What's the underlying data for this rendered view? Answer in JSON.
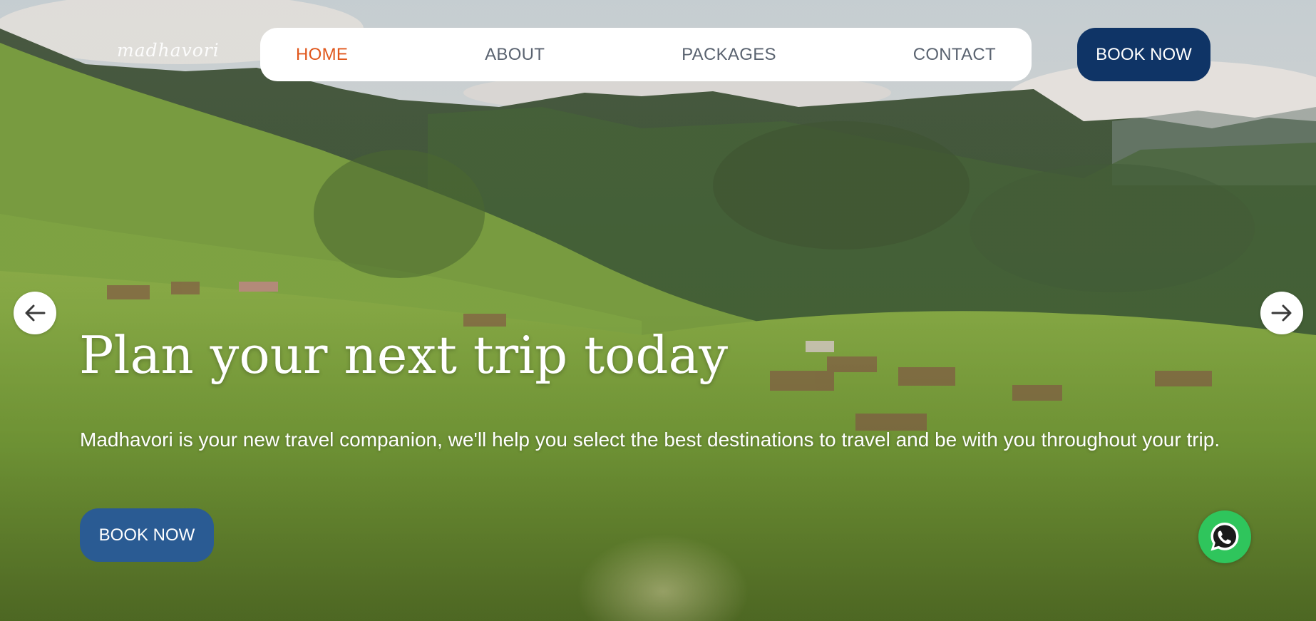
{
  "brand": {
    "logo_text": "madhavori"
  },
  "nav": {
    "items": [
      {
        "label": "HOME",
        "active": true
      },
      {
        "label": "ABOUT",
        "active": false
      },
      {
        "label": "PACKAGES",
        "active": false
      },
      {
        "label": "CONTACT",
        "active": false
      }
    ],
    "book_now_label": "BOOK NOW"
  },
  "hero": {
    "title": "Plan your next trip today",
    "subtitle": "Madhavori is your new travel companion, we'll help you select the best destinations to travel and be with you throughout your trip.",
    "cta_label": "BOOK NOW"
  },
  "carousel": {
    "prev_icon": "arrow-left-icon",
    "next_icon": "arrow-right-icon"
  },
  "floating": {
    "chat_icon": "whatsapp-icon"
  },
  "colors": {
    "nav_active": "#e0571c",
    "nav_text": "#5a6370",
    "book_now_top_bg": "#0f3466",
    "book_now_hero_bg": "#2a5b93",
    "whatsapp_bg": "#2fc55c"
  }
}
